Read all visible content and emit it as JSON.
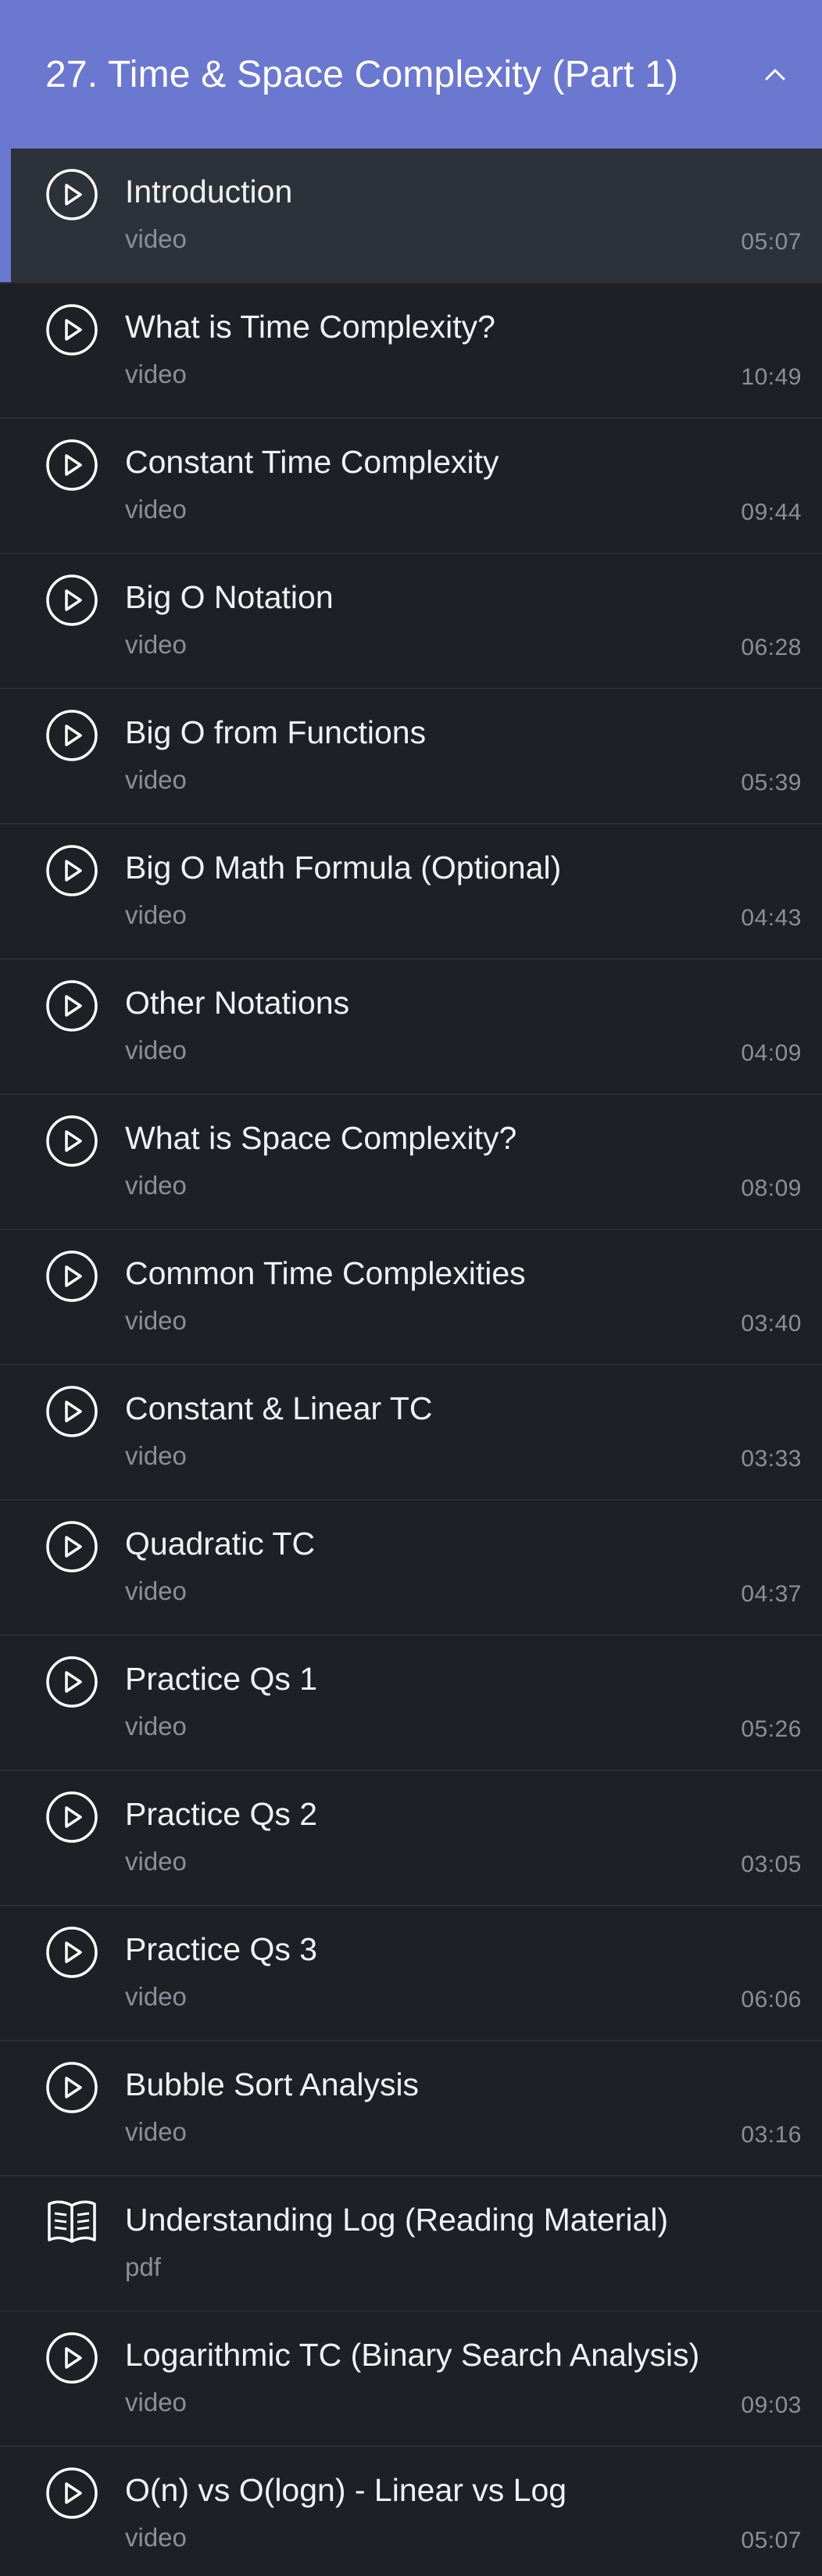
{
  "section": {
    "title": "27. Time & Space Complexity (Part 1)",
    "expanded": true,
    "accent_color": "#6b78d0"
  },
  "lessons": [
    {
      "title": "Introduction",
      "type": "video",
      "duration": "05:07",
      "icon": "play-circle-icon",
      "active": true
    },
    {
      "title": "What is Time Complexity?",
      "type": "video",
      "duration": "10:49",
      "icon": "play-circle-icon"
    },
    {
      "title": "Constant Time Complexity",
      "type": "video",
      "duration": "09:44",
      "icon": "play-circle-icon"
    },
    {
      "title": "Big O Notation",
      "type": "video",
      "duration": "06:28",
      "icon": "play-circle-icon"
    },
    {
      "title": "Big O from Functions",
      "type": "video",
      "duration": "05:39",
      "icon": "play-circle-icon"
    },
    {
      "title": "Big O Math Formula (Optional)",
      "type": "video",
      "duration": "04:43",
      "icon": "play-circle-icon"
    },
    {
      "title": "Other Notations",
      "type": "video",
      "duration": "04:09",
      "icon": "play-circle-icon"
    },
    {
      "title": "What is Space Complexity?",
      "type": "video",
      "duration": "08:09",
      "icon": "play-circle-icon"
    },
    {
      "title": "Common Time Complexities",
      "type": "video",
      "duration": "03:40",
      "icon": "play-circle-icon"
    },
    {
      "title": "Constant & Linear TC",
      "type": "video",
      "duration": "03:33",
      "icon": "play-circle-icon"
    },
    {
      "title": "Quadratic TC",
      "type": "video",
      "duration": "04:37",
      "icon": "play-circle-icon"
    },
    {
      "title": "Practice Qs 1",
      "type": "video",
      "duration": "05:26",
      "icon": "play-circle-icon"
    },
    {
      "title": "Practice Qs 2",
      "type": "video",
      "duration": "03:05",
      "icon": "play-circle-icon"
    },
    {
      "title": "Practice Qs 3",
      "type": "video",
      "duration": "06:06",
      "icon": "play-circle-icon"
    },
    {
      "title": "Bubble Sort Analysis",
      "type": "video",
      "duration": "03:16",
      "icon": "play-circle-icon"
    },
    {
      "title": "Understanding Log (Reading Material)",
      "type": "pdf",
      "duration": "",
      "icon": "book-icon"
    },
    {
      "title": "Logarithmic TC (Binary Search Analysis)",
      "type": "video",
      "duration": "09:03",
      "icon": "play-circle-icon"
    },
    {
      "title": "O(n) vs O(logn) - Linear vs Log",
      "type": "video",
      "duration": "05:07",
      "icon": "play-circle-icon"
    }
  ]
}
